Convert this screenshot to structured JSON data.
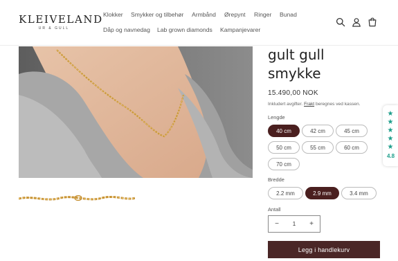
{
  "header": {
    "logo": {
      "name": "KLEIVELAND",
      "tagline": "UR & GULL"
    },
    "nav": [
      {
        "label": "Klokker"
      },
      {
        "label": "Smykker og tilbehør"
      },
      {
        "label": "Armbånd"
      },
      {
        "label": "Ørepynt"
      },
      {
        "label": "Ringer"
      },
      {
        "label": "Bunad"
      },
      {
        "label": "Dåp og navnedag"
      },
      {
        "label": "Lab grown diamonds"
      },
      {
        "label": "Kampanjevarer"
      }
    ],
    "icons": [
      "search-icon",
      "account-icon",
      "cart-icon"
    ]
  },
  "product": {
    "title_line1": "gult gull",
    "title_line2": "smykke",
    "price": "15.490,00 NOK",
    "tax_note_prefix": "Inkludert avgifter.",
    "tax_note_link": "Frakt",
    "tax_note_suffix": "beregnes ved kassen.",
    "length": {
      "label": "Lengde",
      "options": [
        "40 cm",
        "42 cm",
        "45 cm",
        "50 cm",
        "55 cm",
        "60 cm",
        "70 cm"
      ],
      "selected": "40 cm"
    },
    "width": {
      "label": "Bredde",
      "options": [
        "2.2 mm",
        "2.9 mm",
        "3.4 mm"
      ],
      "selected": "2.9 mm"
    },
    "quantity": {
      "label": "Antall",
      "value": "1",
      "minus": "−",
      "plus": "+"
    },
    "add_to_cart": "Legg i handlekurv"
  },
  "reviews": {
    "score": "4.8",
    "stars": 5,
    "color": "#1f9e8b"
  },
  "colors": {
    "accent": "#4a1f1f",
    "button": "#4a2626",
    "review": "#1f9e8b"
  }
}
